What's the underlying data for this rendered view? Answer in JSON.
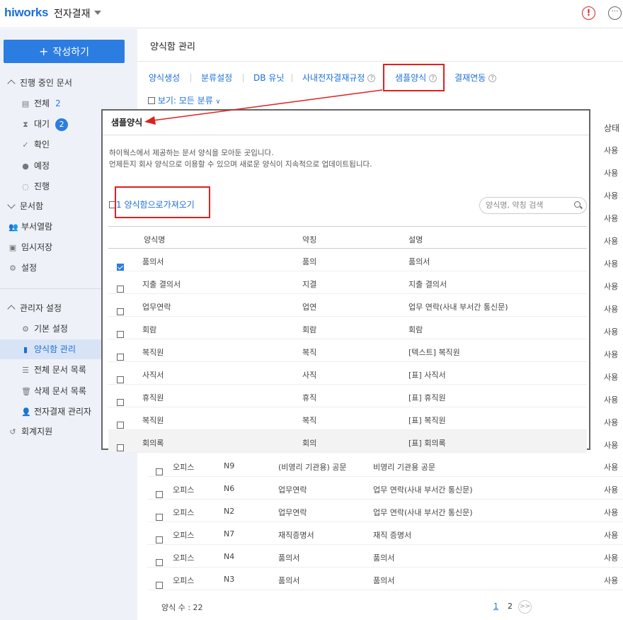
{
  "header": {
    "logo": "hiworks",
    "app_name": "전자결재",
    "alert_icon": "alert-icon",
    "more_icon": "more-icon"
  },
  "sidebar": {
    "write_button": "작성하기",
    "in_progress": {
      "label": "진행 중인 문서",
      "items": [
        {
          "label": "전체",
          "count": "2",
          "icon": "files-icon"
        },
        {
          "label": "대기",
          "count": "2",
          "icon": "hourglass-icon"
        },
        {
          "label": "확인",
          "icon": "check-icon"
        },
        {
          "label": "예정",
          "icon": "clock-icon"
        },
        {
          "label": "진행",
          "icon": "spinner-icon"
        }
      ]
    },
    "docbox": {
      "label": "문서함"
    },
    "dept": {
      "label": "부서열람"
    },
    "temp": {
      "label": "임시저장"
    },
    "settings": {
      "label": "설정"
    },
    "admin": {
      "label": "관리자 설정",
      "items": [
        {
          "label": "기본 설정"
        },
        {
          "label": "양식함 관리"
        },
        {
          "label": "전체 문서 목록"
        },
        {
          "label": "삭제 문서 목록"
        },
        {
          "label": "전자결재 관리자"
        }
      ]
    },
    "accounting": {
      "label": "회계지원"
    }
  },
  "main": {
    "title": "양식함 관리",
    "tabs": [
      "양식생성",
      "분류설정",
      "DB 유닛",
      "사내전자결재규정",
      "샘플양식",
      "결재연동"
    ],
    "viewby": "보기: 모든 분류",
    "status_header": "상태",
    "status_values": [
      "사용",
      "사용",
      "사용",
      "사용",
      "사용",
      "사용",
      "사용",
      "사용",
      "사용",
      "사용",
      "사용",
      "사용",
      "사용",
      "사용",
      "사용",
      "사용",
      "사용"
    ],
    "rows_below": [
      {
        "cat": "오피스",
        "code": "N9",
        "name": "(비영리 기관용) 공문",
        "desc": "비영리 기관용 공문"
      },
      {
        "cat": "오피스",
        "code": "N6",
        "name": "업무연락",
        "desc": "업무 연락(사내 부서간 통신문)"
      },
      {
        "cat": "오피스",
        "code": "N2",
        "name": "업무연락",
        "desc": "업무 연락(사내 부서간 통신문)"
      },
      {
        "cat": "오피스",
        "code": "N7",
        "name": "재직증명서",
        "desc": "재직 증명서"
      },
      {
        "cat": "오피스",
        "code": "N4",
        "name": "품의서",
        "desc": "품의서"
      },
      {
        "cat": "오피스",
        "code": "N3",
        "name": "품의서",
        "desc": "품의서"
      }
    ],
    "form_count": "양식 수 : 22",
    "pages": [
      "1",
      "2"
    ],
    "next_label": ">>"
  },
  "modal": {
    "title": "샘플양식",
    "desc_line1": "하이웍스에서 제공하는 문서 양식을 모아둔 곳입니다.",
    "desc_line2": "언제든지 회사 양식으로 이용할 수 있으며 새로운 양식이 지속적으로 업데이트됩니다.",
    "import_label": "1 양식함으로가져오기",
    "search_placeholder": "양식명, 약칭 검색",
    "columns": [
      "양식명",
      "약칭",
      "설명"
    ],
    "rows": [
      {
        "name": "품의서",
        "abbr": "품의",
        "desc": "품의서",
        "checked": true
      },
      {
        "name": "지출 결의서",
        "abbr": "지결",
        "desc": "지출 결의서",
        "checked": false
      },
      {
        "name": "업무연락",
        "abbr": "업연",
        "desc": "업무 연락(사내 부서간 통신문)",
        "checked": false
      },
      {
        "name": "회람",
        "abbr": "회람",
        "desc": "회람",
        "checked": false
      },
      {
        "name": "복직원",
        "abbr": "복직",
        "desc": "[텍스트] 복직원",
        "checked": false
      },
      {
        "name": "사직서",
        "abbr": "사직",
        "desc": "[표] 사직서",
        "checked": false
      },
      {
        "name": "휴직원",
        "abbr": "휴직",
        "desc": "[표] 휴직원",
        "checked": false
      },
      {
        "name": "복직원",
        "abbr": "복직",
        "desc": "[표] 복직원",
        "checked": false
      },
      {
        "name": "회의록",
        "abbr": "회의",
        "desc": "[표] 회의록",
        "checked": false
      }
    ]
  },
  "colors": {
    "accent": "#2b7de1",
    "highlight": "#e02020"
  }
}
